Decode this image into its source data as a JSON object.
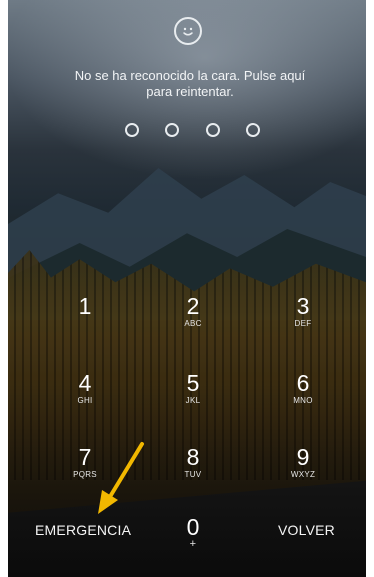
{
  "lock_screen": {
    "face_icon": "face-smile-icon",
    "message_line1": "No se ha reconocido la cara. Pulse aquí",
    "message_line2": "para reintentar.",
    "pin_dot_count": 4
  },
  "keypad": {
    "keys": [
      {
        "digit": "1",
        "letters": ""
      },
      {
        "digit": "2",
        "letters": "ABC"
      },
      {
        "digit": "3",
        "letters": "DEF"
      },
      {
        "digit": "4",
        "letters": "GHI"
      },
      {
        "digit": "5",
        "letters": "JKL"
      },
      {
        "digit": "6",
        "letters": "MNO"
      },
      {
        "digit": "7",
        "letters": "PQRS"
      },
      {
        "digit": "8",
        "letters": "TUV"
      },
      {
        "digit": "9",
        "letters": "WXYZ"
      },
      {
        "digit": "0",
        "letters": "+"
      }
    ],
    "emergency_label": "EMERGENCIA",
    "back_label": "VOLVER"
  },
  "annotation": {
    "arrow_color": "#f2b800",
    "arrow_icon": "arrow-pointing-icon"
  }
}
